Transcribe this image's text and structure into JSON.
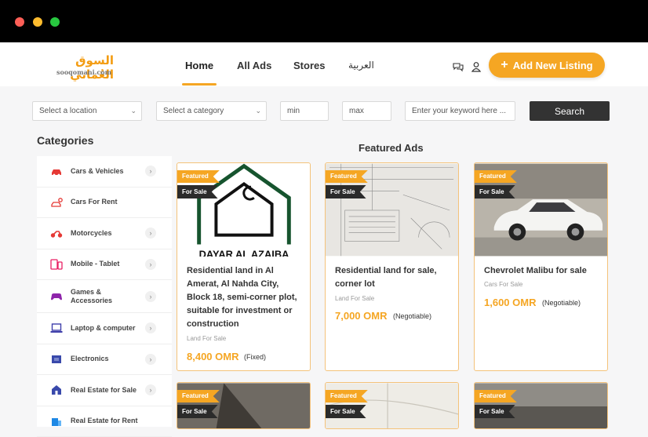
{
  "header": {
    "logo_ar": "السوق العُماني",
    "logo_en": "sooqomani.com",
    "nav": {
      "home": "Home",
      "all_ads": "All Ads",
      "stores": "Stores",
      "lang": "العربية"
    },
    "add_listing": "Add New Listing",
    "accent": "#f5a623"
  },
  "filters": {
    "location": "Select a location",
    "category": "Select a category",
    "min_placeholder": "min",
    "max_placeholder": "max",
    "keyword_placeholder": "Enter your keyword here ...",
    "search_label": "Search"
  },
  "categories": {
    "title": "Categories",
    "items": [
      {
        "label": "Cars & Vehicles",
        "icon": "car-icon"
      },
      {
        "label": "Cars For Rent",
        "icon": "car-key-icon"
      },
      {
        "label": "Motorcycles",
        "icon": "motorcycle-icon"
      },
      {
        "label": "Mobile - Tablet",
        "icon": "mobile-icon"
      },
      {
        "label": "Games & Accessories",
        "icon": "gamepad-icon"
      },
      {
        "label": "Laptop & computer",
        "icon": "laptop-icon"
      },
      {
        "label": "Electronics",
        "icon": "electronics-icon"
      },
      {
        "label": "Real Estate for Sale",
        "icon": "house-icon"
      },
      {
        "label": "Real Estate for Rent",
        "icon": "building-icon"
      }
    ]
  },
  "featured": {
    "title": "Featured Ads",
    "badge_featured": "Featured",
    "badge_sale": "For Sale",
    "ads": [
      {
        "title": "Residential land in Al Amerat, Al Nahda City, Block 18, semi-corner plot, suitable for investment or construction",
        "category": "Land For Sale",
        "price": "8,400 OMR",
        "note": "(Fixed)",
        "image_text": "DAYAR AL AZAIBA"
      },
      {
        "title": "Residential land for sale, corner lot",
        "category": "Land For Sale",
        "price": "7,000 OMR",
        "note": "(Negotiable)"
      },
      {
        "title": "Chevrolet Malibu for sale",
        "category": "Cars For Sale",
        "price": "1,600 OMR",
        "note": "(Negotiable)"
      },
      {
        "title": "",
        "category": "",
        "price": "",
        "note": ""
      },
      {
        "title": "",
        "category": "",
        "price": "",
        "note": ""
      },
      {
        "title": "",
        "category": "",
        "price": "",
        "note": ""
      }
    ]
  }
}
